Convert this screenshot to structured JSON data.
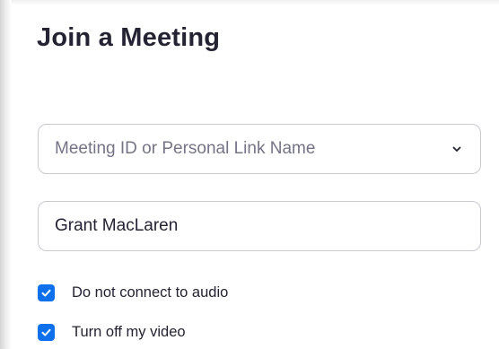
{
  "dialog": {
    "title": "Join a Meeting"
  },
  "meeting_id": {
    "placeholder": "Meeting ID or Personal Link Name",
    "value": "",
    "dropdown_icon": "chevron-down-icon"
  },
  "name_field": {
    "value": "Grant MacLaren"
  },
  "options": [
    {
      "label": "Do not connect to audio",
      "checked": true
    },
    {
      "label": "Turn off my video",
      "checked": true
    }
  ],
  "colors": {
    "accent": "#0e71eb",
    "text": "#232333",
    "placeholder": "#747487",
    "border": "#c9c9cf"
  }
}
